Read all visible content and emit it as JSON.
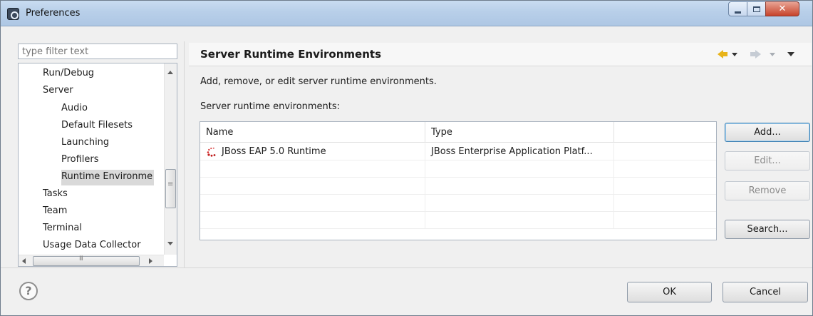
{
  "window": {
    "title": "Preferences"
  },
  "filter": {
    "placeholder": "type filter text"
  },
  "tree": {
    "items": [
      {
        "label": "Run/Debug",
        "level": 0
      },
      {
        "label": "Server",
        "level": 0
      },
      {
        "label": "Audio",
        "level": 1
      },
      {
        "label": "Default Filesets",
        "level": 1
      },
      {
        "label": "Launching",
        "level": 1
      },
      {
        "label": "Profilers",
        "level": 1
      },
      {
        "label": "Runtime Environme",
        "level": 1,
        "selected": true
      },
      {
        "label": "Tasks",
        "level": 0
      },
      {
        "label": "Team",
        "level": 0
      },
      {
        "label": "Terminal",
        "level": 0
      },
      {
        "label": "Usage Data Collector",
        "level": 0
      }
    ]
  },
  "page": {
    "title": "Server Runtime Environments",
    "description": "Add, remove, or edit server runtime environments.",
    "list_label": "Server runtime environments:"
  },
  "table": {
    "columns": [
      "Name",
      "Type",
      ""
    ],
    "rows": [
      {
        "name": "JBoss EAP 5.0 Runtime",
        "type": "JBoss Enterprise Application Platf...",
        "icon": "jboss-server-icon"
      }
    ]
  },
  "buttons": {
    "add": "Add...",
    "edit": "Edit...",
    "remove": "Remove",
    "search": "Search...",
    "ok": "OK",
    "cancel": "Cancel"
  },
  "colors": {
    "nav_back_arrow": "#e8b318",
    "nav_forward_arrow": "#c6ccd4",
    "close_button": "#c7432b"
  }
}
